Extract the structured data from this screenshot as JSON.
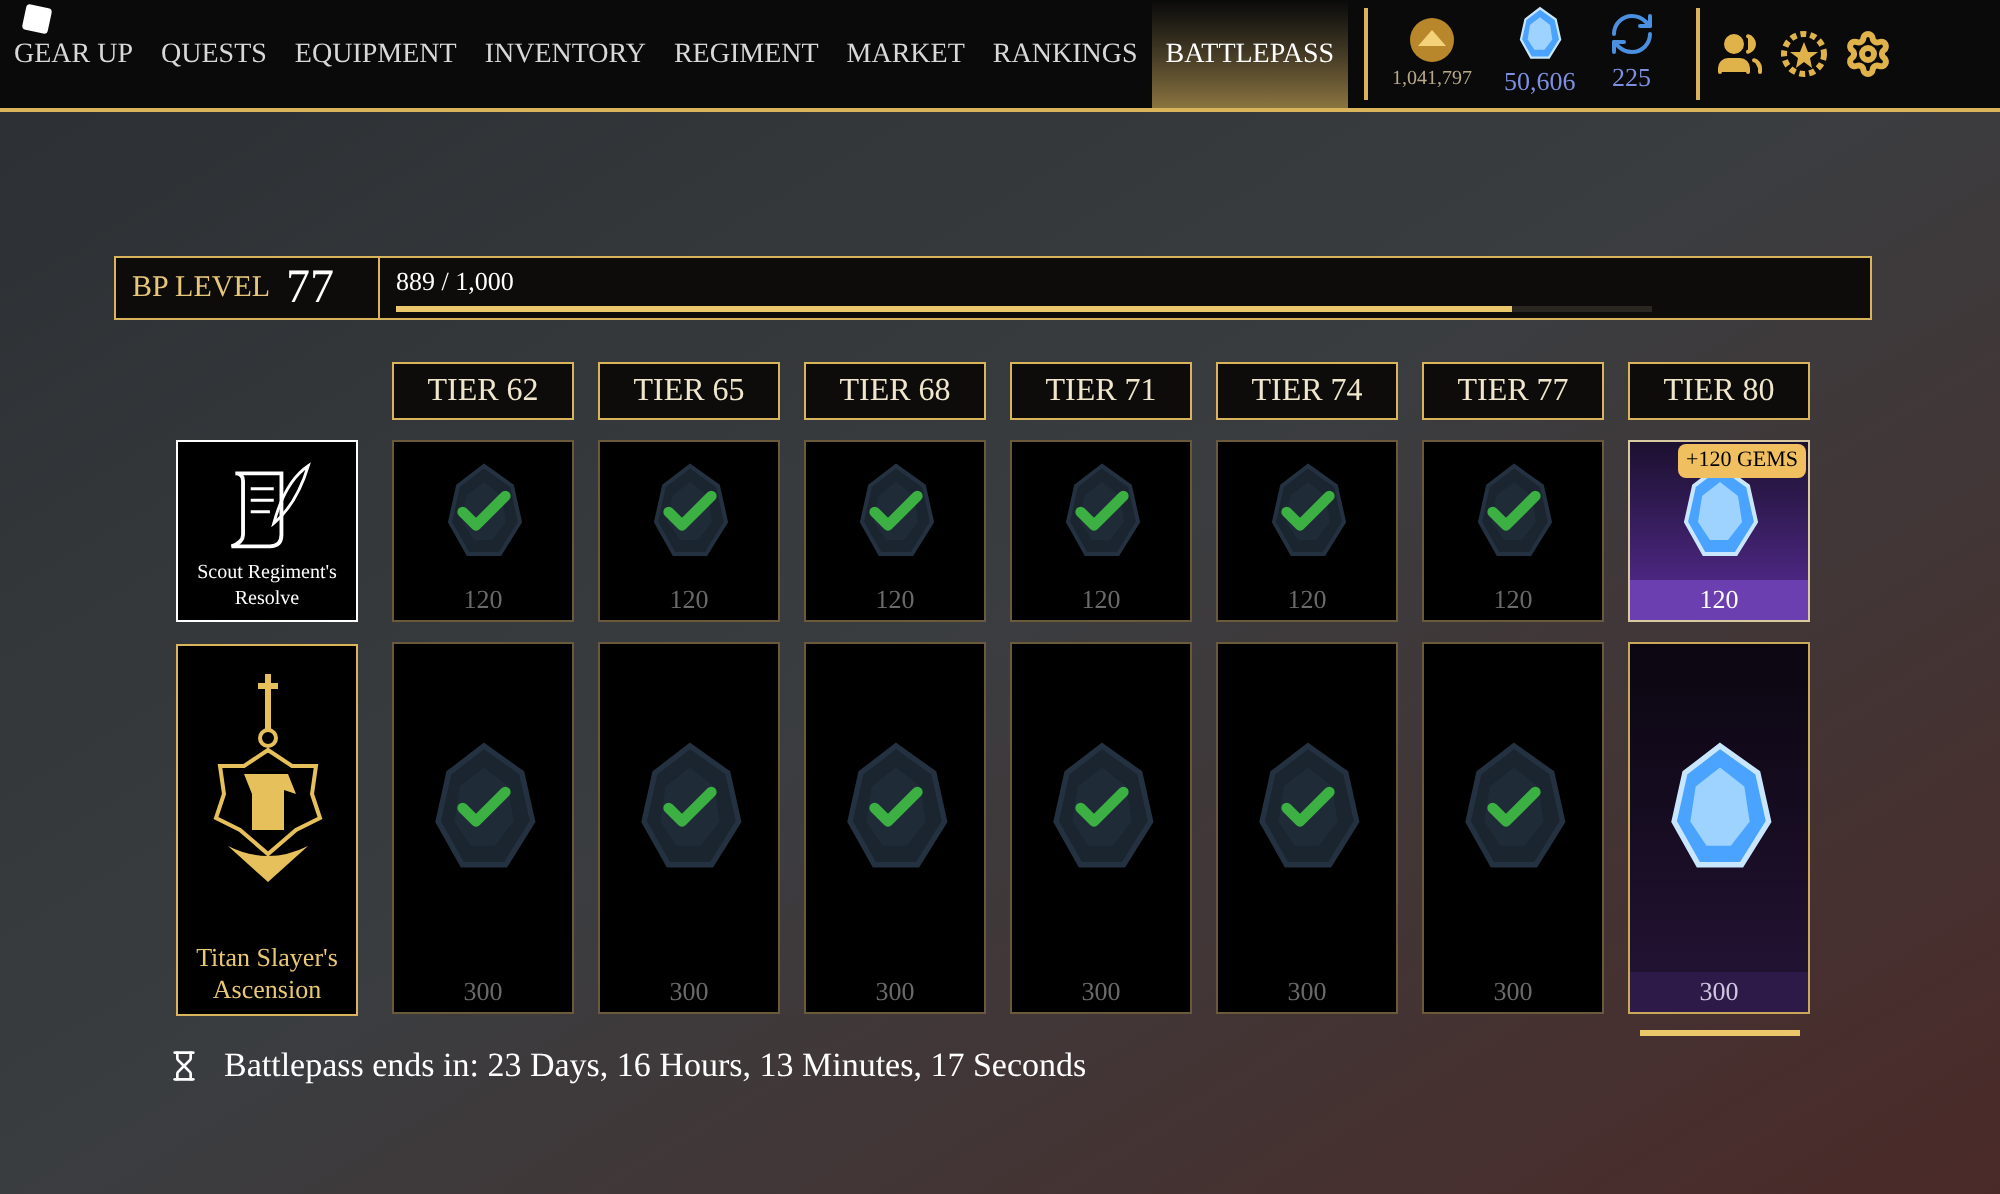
{
  "nav": {
    "tabs": [
      {
        "label": "GEAR UP",
        "selected": false
      },
      {
        "label": "QUESTS",
        "selected": false
      },
      {
        "label": "EQUIPMENT",
        "selected": false
      },
      {
        "label": "INVENTORY",
        "selected": false
      },
      {
        "label": "REGIMENT",
        "selected": false
      },
      {
        "label": "MARKET",
        "selected": false
      },
      {
        "label": "RANKINGS",
        "selected": false
      },
      {
        "label": "BATTLEPASS",
        "selected": true
      }
    ],
    "currencies": [
      {
        "kind": "coin",
        "amount": "1,041,797"
      },
      {
        "kind": "gem",
        "amount": "50,606"
      },
      {
        "kind": "reroll",
        "amount": "225"
      }
    ]
  },
  "bp": {
    "label": "BP LEVEL",
    "level_value": "77",
    "progress_text": "889 / 1,000",
    "level": 0.889
  },
  "tracks": [
    {
      "kind": "free",
      "name": "Scout Regiment's Resolve"
    },
    {
      "kind": "premium",
      "name": "Titan Slayer's Ascension"
    }
  ],
  "tiers": [
    {
      "label": "TIER 62",
      "claimed": true,
      "free_amount": "120",
      "premium_amount": "300"
    },
    {
      "label": "TIER 65",
      "claimed": true,
      "free_amount": "120",
      "premium_amount": "300"
    },
    {
      "label": "TIER 68",
      "claimed": true,
      "free_amount": "120",
      "premium_amount": "300"
    },
    {
      "label": "TIER 71",
      "claimed": true,
      "free_amount": "120",
      "premium_amount": "300"
    },
    {
      "label": "TIER 74",
      "claimed": true,
      "free_amount": "120",
      "premium_amount": "300"
    },
    {
      "label": "TIER 77",
      "claimed": true,
      "free_amount": "120",
      "premium_amount": "300"
    },
    {
      "label": "TIER 80",
      "claimed": false,
      "free_amount": "120",
      "free_badge": "+120 GEMS",
      "premium_amount": "300"
    }
  ],
  "timer": {
    "text": "Battlepass ends in: 23 Days, 16 Hours, 13 Minutes, 17 Seconds"
  }
}
